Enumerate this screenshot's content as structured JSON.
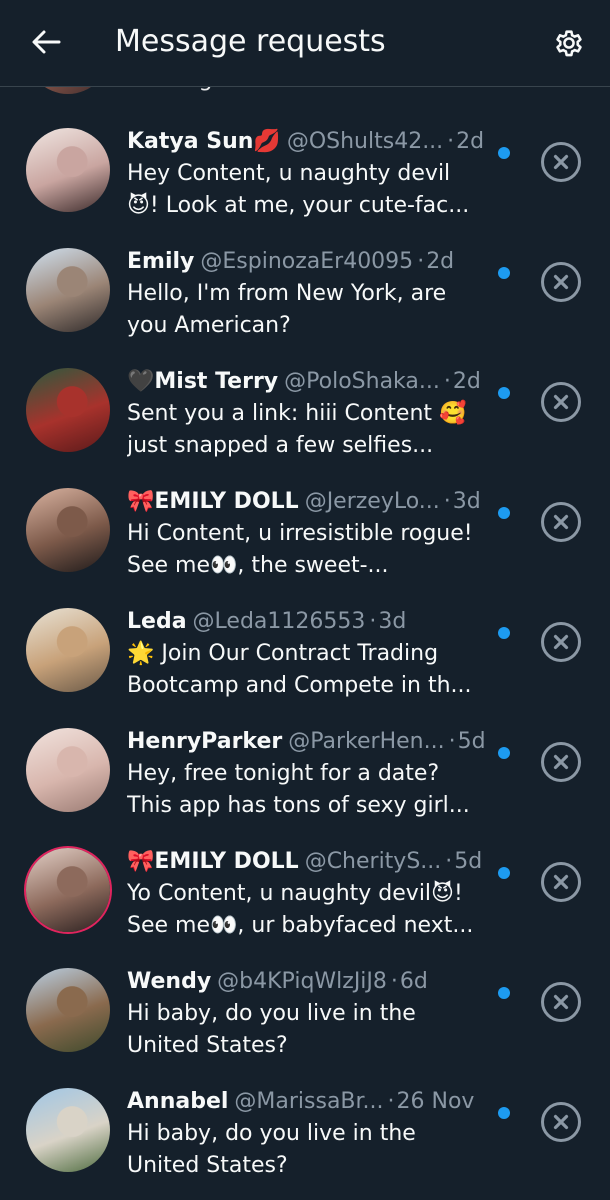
{
  "header": {
    "title": "Message requests",
    "back_icon": "arrow-left-icon",
    "settings_icon": "gear-icon"
  },
  "partial_item": {
    "preview": "Looking for someone to video..."
  },
  "requests": [
    {
      "name": "Katya Sun💋",
      "handle": "@OShults42...",
      "time": "2d",
      "preview": "Hey Content, u naughty devil 😈! Look at me, your cute-fac...",
      "avatar_colors": [
        "#f0e6e2",
        "#c9a5a0",
        "#3b2a2a"
      ],
      "ring": false
    },
    {
      "name": "Emily",
      "handle": "@EspinozaEr40095",
      "time": "2d",
      "preview": "Hello, I'm from New York, are you American?",
      "avatar_colors": [
        "#cfe0ef",
        "#9b8576",
        "#2f2a2a"
      ],
      "ring": false
    },
    {
      "name": "🖤Mist Terry",
      "handle": "@PoloShaka...",
      "time": "2d",
      "preview": "Sent you a link: hiii Content 🥰 just snapped a few selfies...",
      "avatar_colors": [
        "#2b5a3e",
        "#a8322c",
        "#5a1a1a"
      ],
      "ring": false
    },
    {
      "name": "🎀EMILY DOLL",
      "handle": "@JerzeyLo...",
      "time": "3d",
      "preview": "Hi  Content, u irresistible rogue! See me👀, the sweet-...",
      "avatar_colors": [
        "#d9b3a1",
        "#7d5a4a",
        "#1e1a1a"
      ],
      "ring": false
    },
    {
      "name": "Leda",
      "handle": "@Leda1126553",
      "time": "3d",
      "preview": "🌟 Join Our Contract Trading Bootcamp and Compete in th...",
      "avatar_colors": [
        "#e8e2d5",
        "#c8a27a",
        "#6b5a48"
      ],
      "ring": false
    },
    {
      "name": "HenryParker",
      "handle": "@ParkerHen...",
      "time": "5d",
      "preview": "Hey, free tonight for a date? This app has tons of sexy girl...",
      "avatar_colors": [
        "#f1e3de",
        "#d8b6ad",
        "#9a7b73"
      ],
      "ring": false
    },
    {
      "name": "🎀EMILY DOLL",
      "handle": "@CherityS...",
      "time": "5d",
      "preview": "Yo  Content, u naughty devil😈! See me👀, ur babyfaced next...",
      "avatar_colors": [
        "#e2cfc6",
        "#8d6a5c",
        "#2a2020"
      ],
      "ring": true
    },
    {
      "name": "Wendy",
      "handle": "@b4KPiqWlzJiJ8",
      "time": "6d",
      "preview": "Hi baby, do you live in the United States?",
      "avatar_colors": [
        "#b9cfe3",
        "#8a6a4e",
        "#3e4a2c"
      ],
      "ring": false
    },
    {
      "name": "Annabel",
      "handle": "@MarissaBr...",
      "time": "26 Nov",
      "preview": "Hi baby, do you live in the United States?",
      "avatar_colors": [
        "#9fc6e6",
        "#d9d3c7",
        "#4d6b3e"
      ],
      "ring": false
    }
  ],
  "colors": {
    "background": "#15202b",
    "unread_dot": "#1d9bf0",
    "secondary_text": "#8b98a5",
    "dismiss_icon": "#8b98a5"
  },
  "icons": {
    "dismiss": "close-circle-icon",
    "unread": "unread-dot-icon"
  }
}
